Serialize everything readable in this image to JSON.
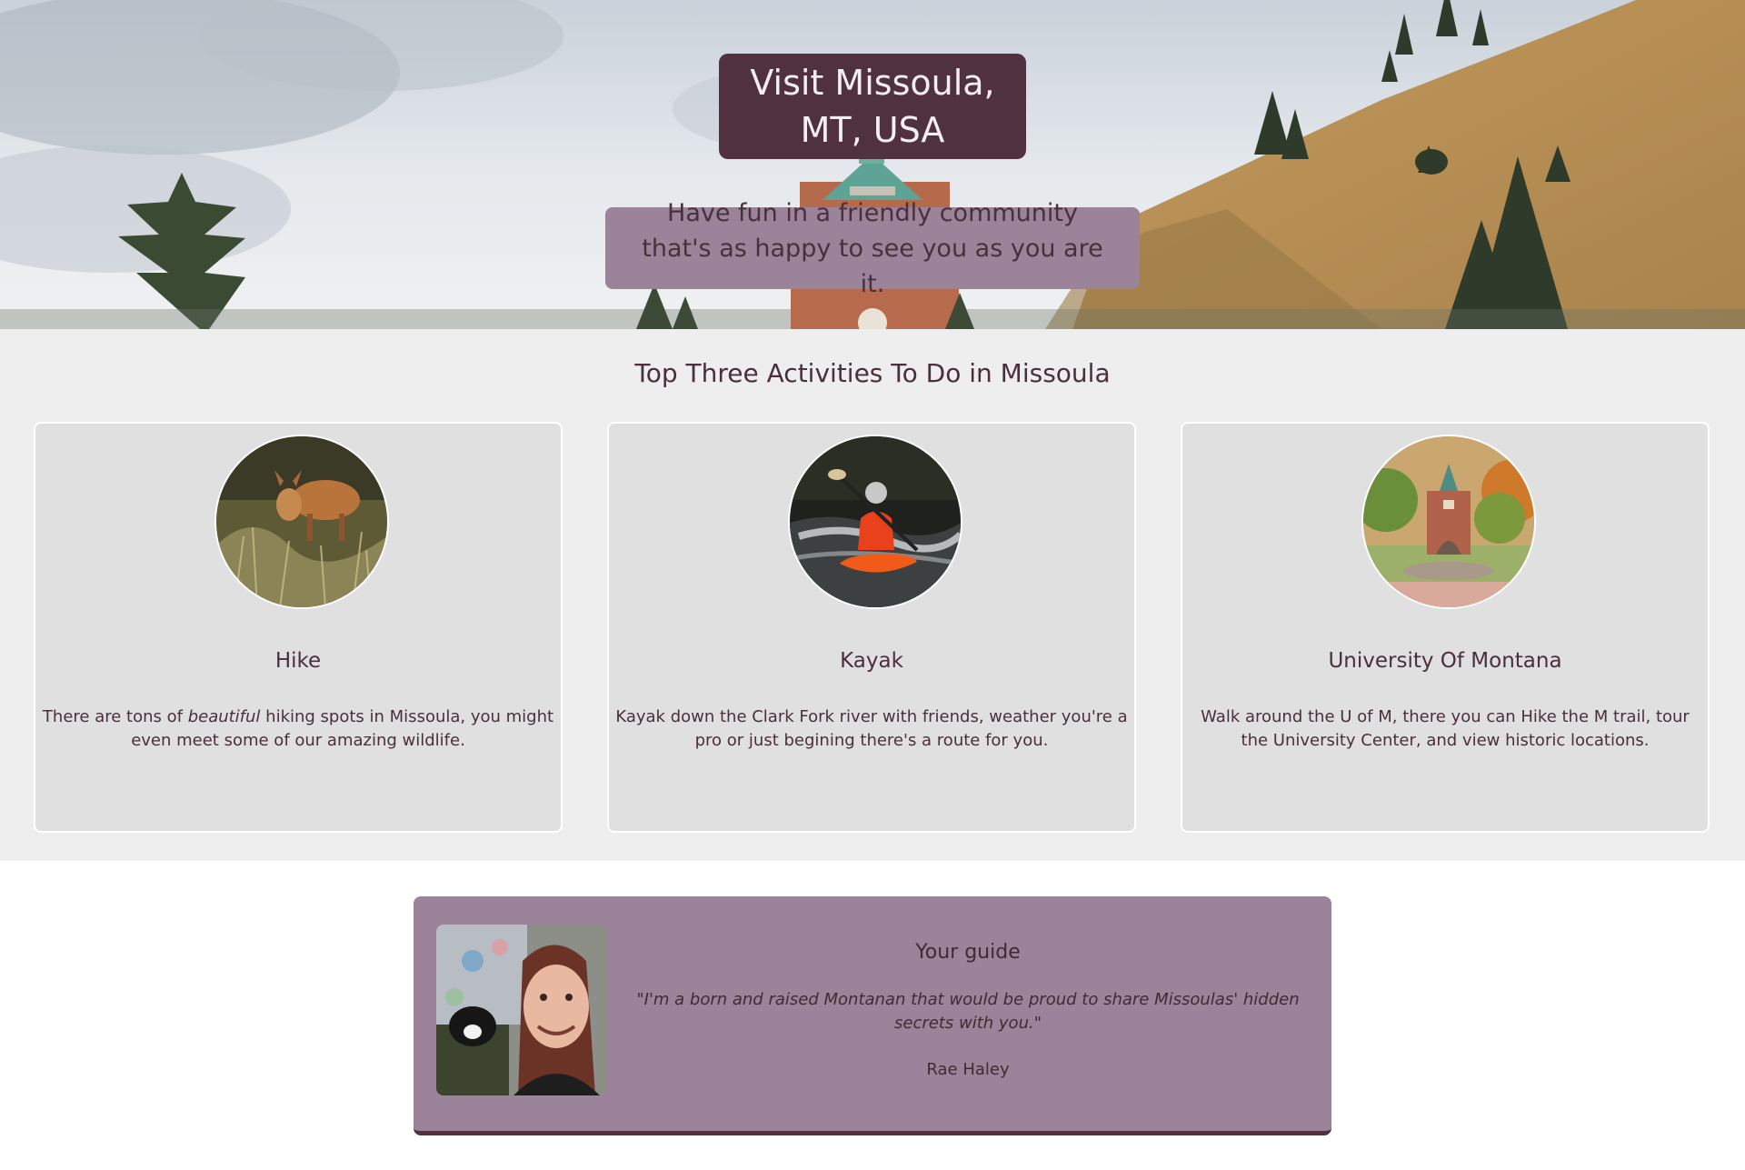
{
  "hero": {
    "title": "Visit Missoula, MT, USA",
    "tagline": "Have fun in a friendly community that's as happy to see you as you are it."
  },
  "activities": {
    "heading": "Top Three Activities To Do in Missoula",
    "cards": [
      {
        "title": "Hike",
        "text_before": "There are tons of ",
        "text_emphasis": "beautiful",
        "text_after": " hiking spots in Missoula, you might even meet some of our amazing wildlife.",
        "image": "deer-photo"
      },
      {
        "title": "Kayak",
        "text": "Kayak down the Clark Fork river with friends, weather you're a pro or just begining there's a route for you.",
        "image": "kayak-photo"
      },
      {
        "title": "University Of Montana",
        "text": "Walk around the U of M, there you can Hike the M trail, tour the University Center, and view historic locations.",
        "image": "university-photo"
      }
    ]
  },
  "guide": {
    "heading": "Your guide",
    "quote": "\"I'm a born and raised Montanan that would be proud to share Missoulas' hidden secrets with you.\"",
    "name": "Rae Haley",
    "image": "guide-portrait"
  },
  "colors": {
    "primary": "#50313f",
    "accent": "#9b8499",
    "section_bg": "#eeeeee",
    "card_bg": "#e0e0e0"
  }
}
